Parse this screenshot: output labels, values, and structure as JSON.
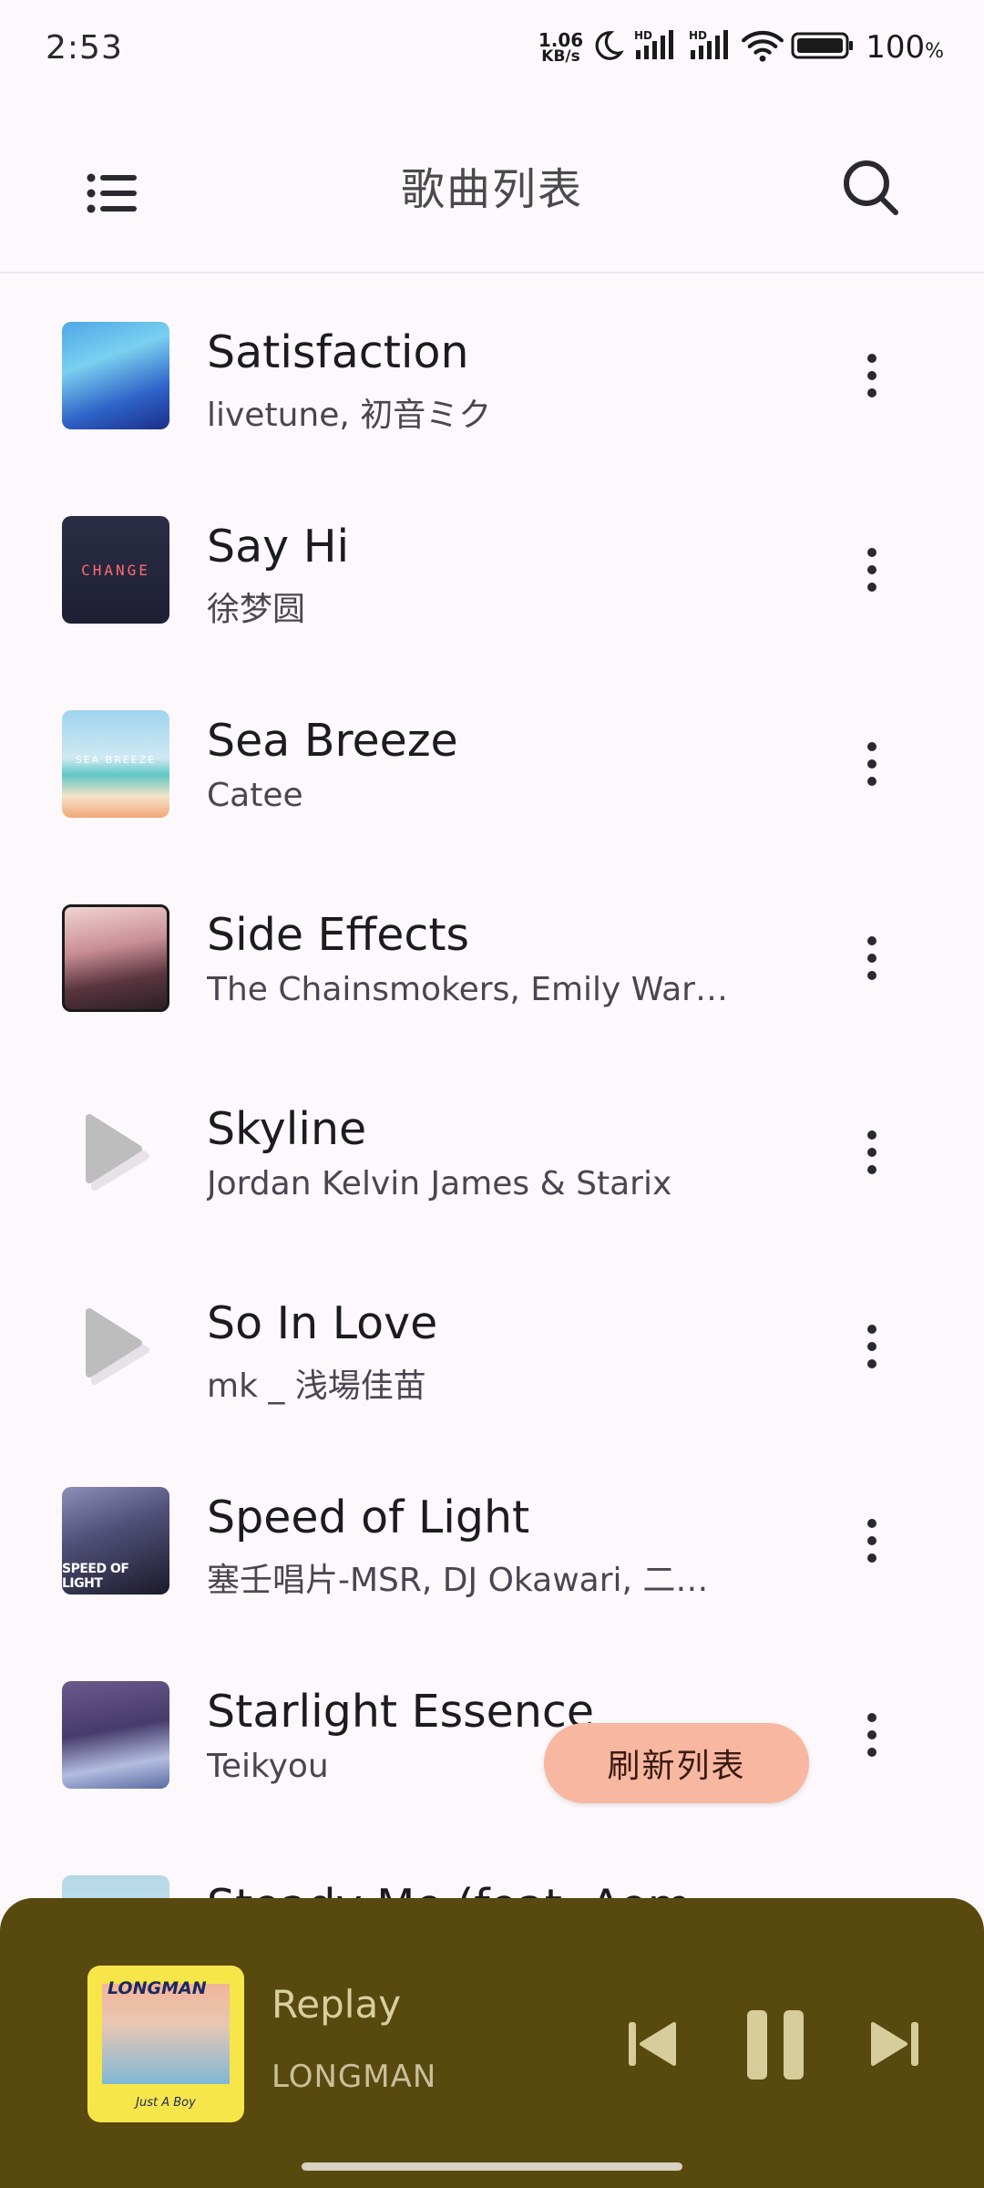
{
  "status_bar": {
    "time": "2:53",
    "net_speed_value": "1.06",
    "net_speed_unit": "KB/s",
    "signal_1_label": "HD",
    "signal_2_label": "HD",
    "battery_percent": "100",
    "battery_unit": "%"
  },
  "app_bar": {
    "title": "歌曲列表",
    "menu_icon": "menu-icon",
    "search_icon": "search-icon"
  },
  "songs": [
    {
      "title": "Satisfaction",
      "artist": "livetune, 初音ミク",
      "cover": "album-art"
    },
    {
      "title": "Say Hi",
      "artist": "徐梦圆",
      "cover": "album-art",
      "cover_text": "CHANGE"
    },
    {
      "title": "Sea Breeze",
      "artist": "Catee",
      "cover": "album-art",
      "cover_text": "SEA BREEZE"
    },
    {
      "title": "Side Effects",
      "artist": "The Chainsmokers, Emily War…",
      "cover": "album-art"
    },
    {
      "title": "Skyline",
      "artist": "Jordan Kelvin James & Starix",
      "cover": "play-placeholder-icon"
    },
    {
      "title": "So In Love",
      "artist": "mk _ 浅場佳苗",
      "cover": "play-placeholder-icon"
    },
    {
      "title": "Speed of Light",
      "artist": "塞壬唱片-MSR, DJ Okawari, 二…",
      "cover": "album-art",
      "cover_text": "SPEED OF LIGHT"
    },
    {
      "title": "Starlight Essence",
      "artist": "Teikyou",
      "cover": "album-art"
    },
    {
      "title": "Steady Me (feat. Aom…",
      "artist": "",
      "cover": "album-art"
    }
  ],
  "refresh_button": {
    "label": "刷新列表"
  },
  "mini_player": {
    "title": "Replay",
    "artist": "LONGMAN",
    "cover_logo": "LONGMAN",
    "cover_subtitle": "Just A Boy",
    "prev_icon": "skip-previous-icon",
    "pause_icon": "pause-icon",
    "next_icon": "skip-next-icon"
  },
  "colors": {
    "background": "#fdf8fc",
    "fab": "#f7b7a0",
    "player_bg": "#58490f",
    "player_text": "#d8cf9e"
  }
}
